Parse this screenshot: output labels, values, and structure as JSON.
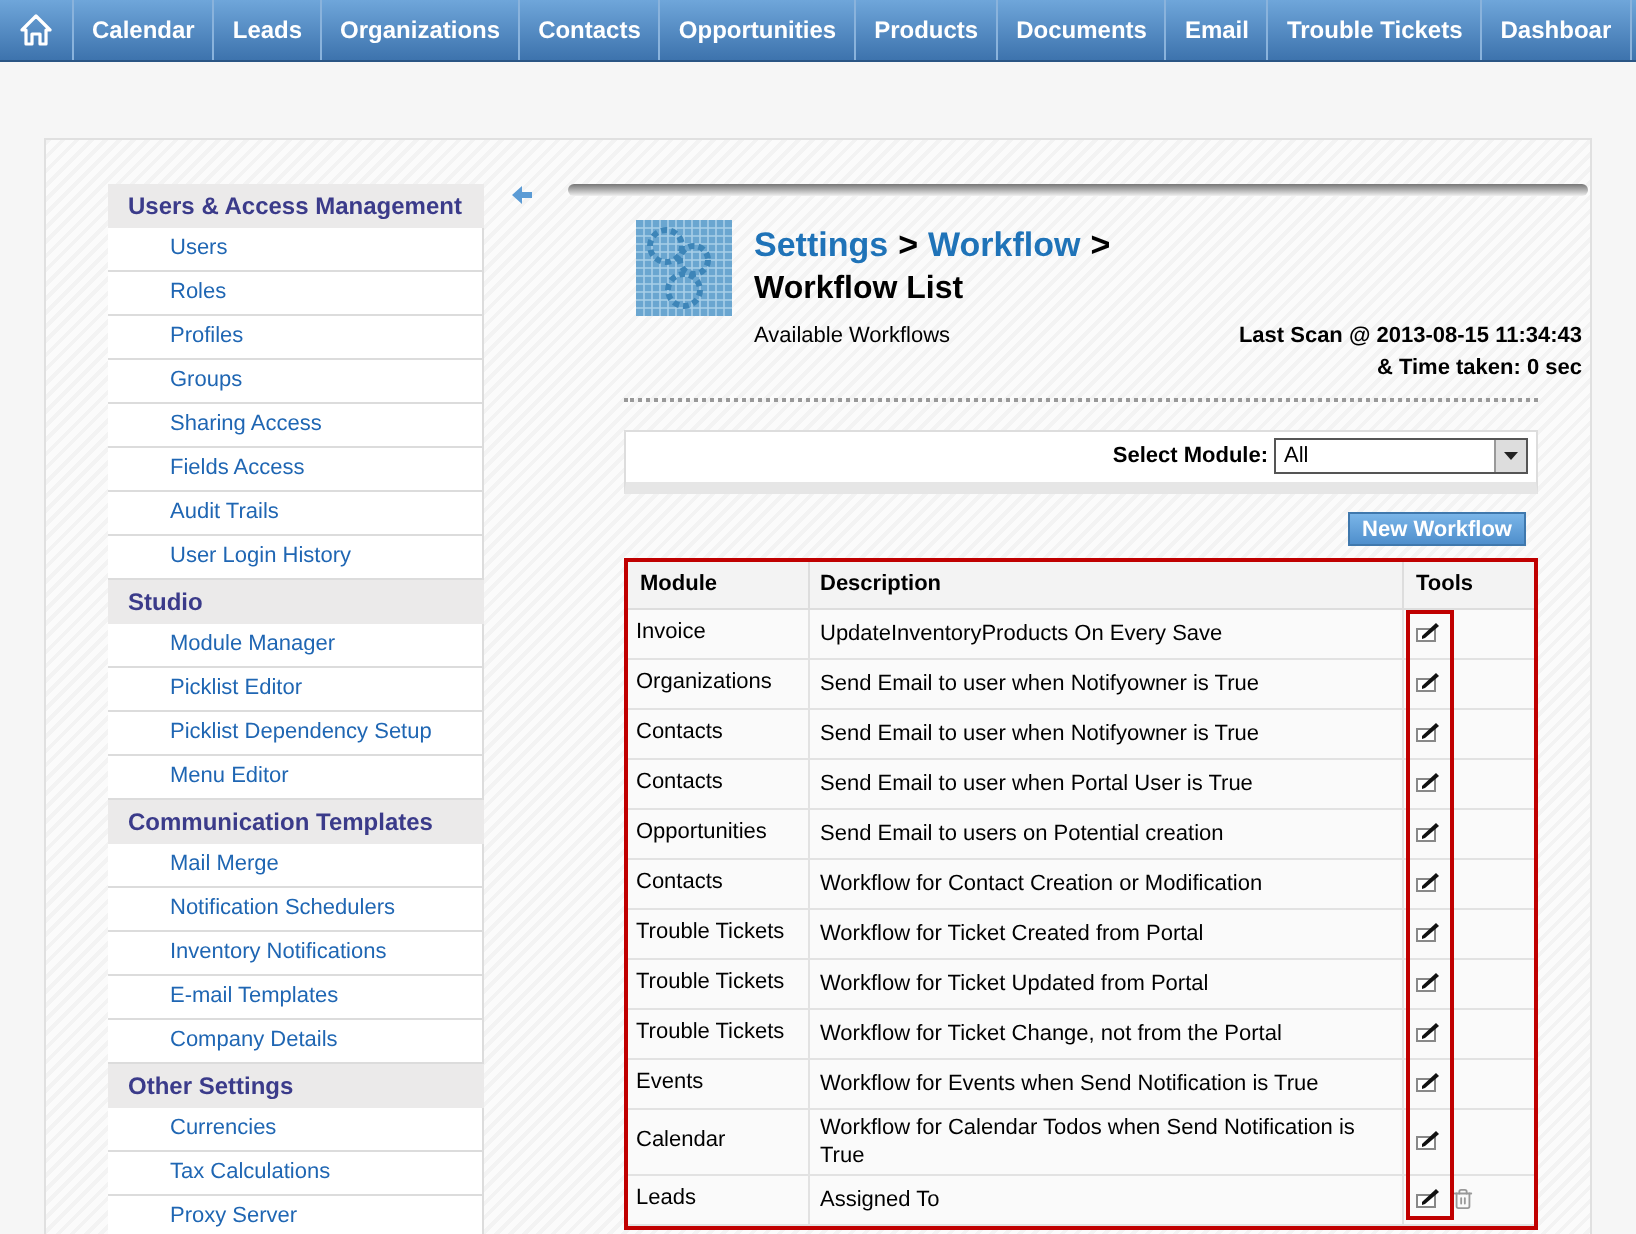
{
  "nav": {
    "items": [
      "Calendar",
      "Leads",
      "Organizations",
      "Contacts",
      "Opportunities",
      "Products",
      "Documents",
      "Email",
      "Trouble Tickets",
      "Dashboar"
    ]
  },
  "sidebar": {
    "sections": [
      {
        "title": "Users & Access Management",
        "items": [
          "Users",
          "Roles",
          "Profiles",
          "Groups",
          "Sharing Access",
          "Fields Access",
          "Audit Trails",
          "User Login History"
        ]
      },
      {
        "title": "Studio",
        "items": [
          "Module Manager",
          "Picklist Editor",
          "Picklist Dependency Setup",
          "Menu Editor"
        ]
      },
      {
        "title": "Communication Templates",
        "items": [
          "Mail Merge",
          "Notification Schedulers",
          "Inventory Notifications",
          "E-mail Templates",
          "Company Details"
        ]
      },
      {
        "title": "Other Settings",
        "items": [
          "Currencies",
          "Tax Calculations",
          "Proxy Server"
        ]
      }
    ]
  },
  "breadcrumb": {
    "links": [
      "Settings",
      "Workflow"
    ],
    "separator": ">",
    "title": "Workflow List"
  },
  "subtitle": "Available Workflows",
  "last_scan": "Last Scan @ 2013-08-15 11:34:43",
  "time_taken": "& Time taken: 0 sec",
  "module_select": {
    "label": "Select Module:",
    "value": "All"
  },
  "new_button": "New Workflow",
  "table": {
    "columns": [
      "Module",
      "Description",
      "Tools"
    ],
    "rows": [
      {
        "module": "Invoice",
        "description": "UpdateInventoryProducts On Every Save",
        "deletable": false
      },
      {
        "module": "Organizations",
        "description": "Send Email to user when Notifyowner is True",
        "deletable": false
      },
      {
        "module": "Contacts",
        "description": "Send Email to user when Notifyowner is True",
        "deletable": false
      },
      {
        "module": "Contacts",
        "description": "Send Email to user when Portal User is True",
        "deletable": false
      },
      {
        "module": "Opportunities",
        "description": "Send Email to users on Potential creation",
        "deletable": false
      },
      {
        "module": "Contacts",
        "description": "Workflow for Contact Creation or Modification",
        "deletable": false
      },
      {
        "module": "Trouble Tickets",
        "description": "Workflow for Ticket Created from Portal",
        "deletable": false
      },
      {
        "module": "Trouble Tickets",
        "description": "Workflow for Ticket Updated from Portal",
        "deletable": false
      },
      {
        "module": "Trouble Tickets",
        "description": "Workflow for Ticket Change, not from the Portal",
        "deletable": false
      },
      {
        "module": "Events",
        "description": "Workflow for Events when Send Notification is True",
        "deletable": false
      },
      {
        "module": "Calendar",
        "description": "Workflow for Calendar Todos when Send Notification is True",
        "deletable": false
      },
      {
        "module": "Leads",
        "description": "Assigned To",
        "deletable": true
      }
    ]
  }
}
